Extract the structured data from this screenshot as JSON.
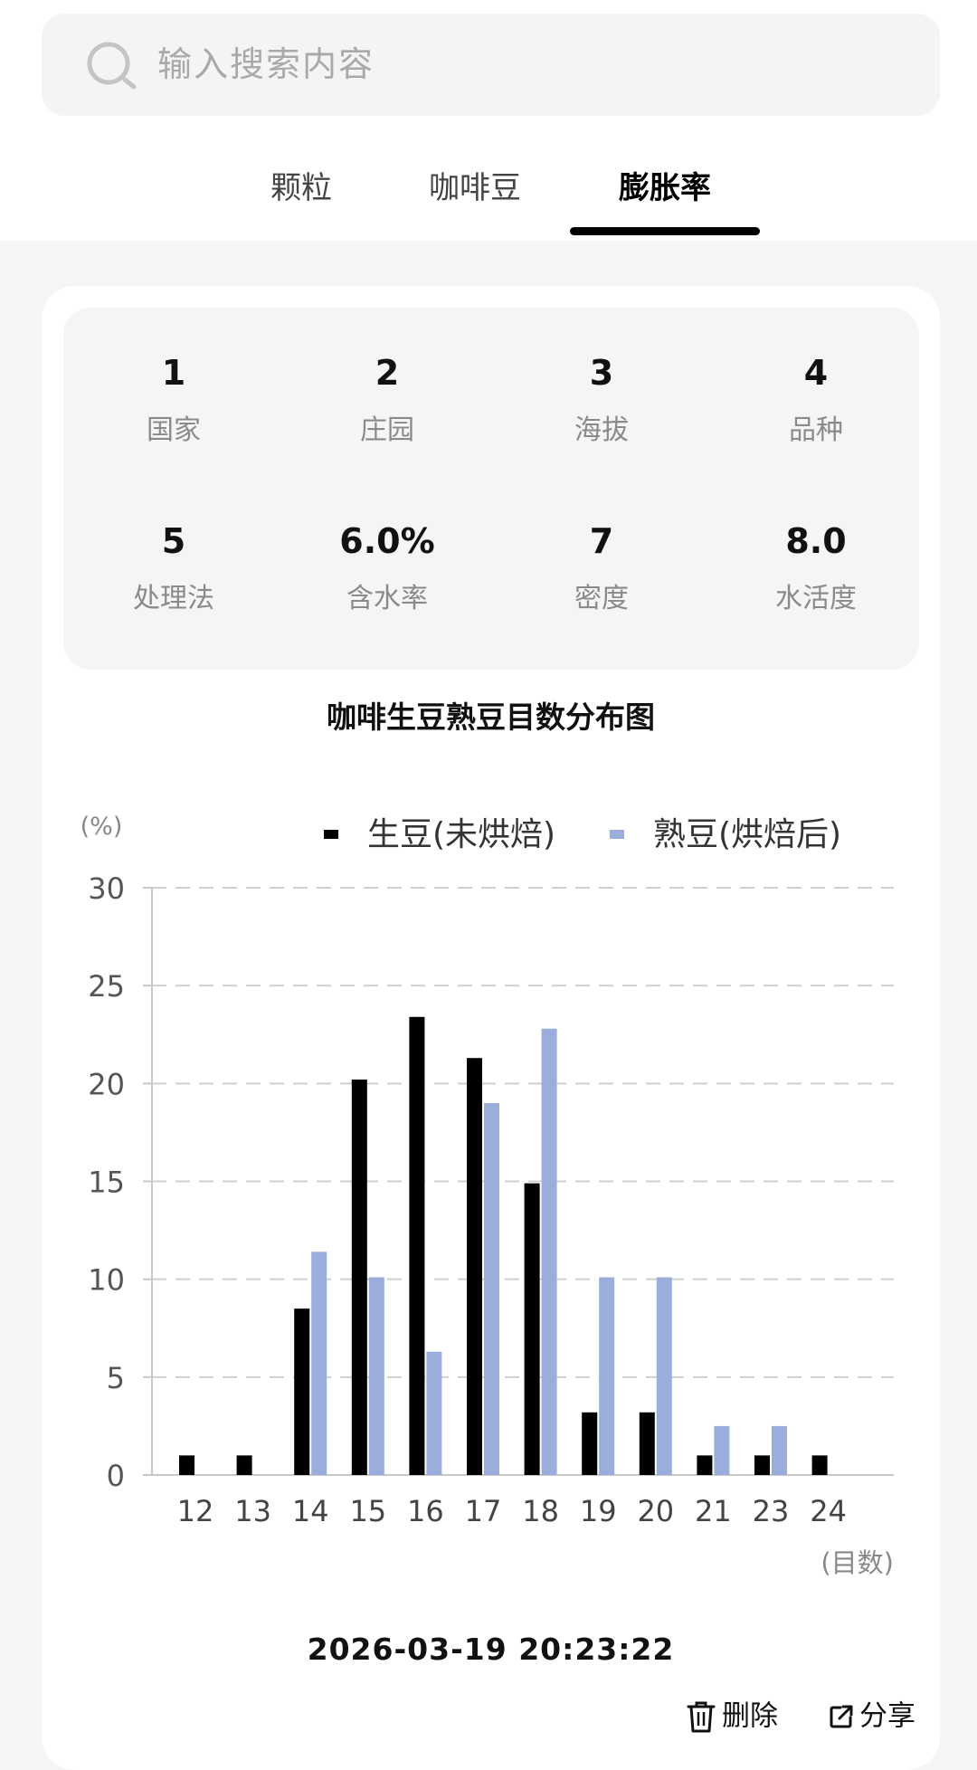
{
  "search": {
    "placeholder": "输入搜索内容"
  },
  "tabs": [
    {
      "label": "颗粒",
      "active": false
    },
    {
      "label": "咖啡豆",
      "active": false
    },
    {
      "label": "膨胀率",
      "active": true
    }
  ],
  "stats": [
    {
      "value": "1",
      "label": "国家"
    },
    {
      "value": "2",
      "label": "庄园"
    },
    {
      "value": "3",
      "label": "海拔"
    },
    {
      "value": "4",
      "label": "品种"
    },
    {
      "value": "5",
      "label": "处理法"
    },
    {
      "value": "6.0%",
      "label": "含水率"
    },
    {
      "value": "7",
      "label": "密度"
    },
    {
      "value": "8.0",
      "label": "水活度"
    }
  ],
  "chart_data": {
    "type": "bar",
    "title": "咖啡生豆熟豆目数分布图",
    "ylabel": "(%)",
    "xlabel": "(目数)",
    "categories": [
      "12",
      "13",
      "14",
      "15",
      "16",
      "17",
      "18",
      "19",
      "20",
      "21",
      "23",
      "24"
    ],
    "series": [
      {
        "name": "生豆(未烘焙)",
        "color": "#000000",
        "values": [
          1,
          1,
          8.5,
          20.2,
          23.4,
          21.3,
          14.9,
          3.2,
          3.2,
          1,
          1,
          1
        ]
      },
      {
        "name": "熟豆(烘焙后)",
        "color": "#9aaddb",
        "values": [
          0,
          0,
          11.4,
          10.1,
          6.3,
          19,
          22.8,
          10.1,
          10.1,
          2.5,
          2.5,
          0
        ]
      }
    ],
    "yticks": [
      0,
      5,
      10,
      15,
      20,
      25,
      30
    ],
    "ylim": [
      0,
      30
    ],
    "grid": true,
    "legend_position": "top"
  },
  "timestamp": "2026-03-19 20:23:22",
  "actions": {
    "delete_label": "删除",
    "share_label": "分享"
  },
  "icons": {
    "search": "search-icon",
    "delete": "trash-icon",
    "share": "share-icon"
  }
}
